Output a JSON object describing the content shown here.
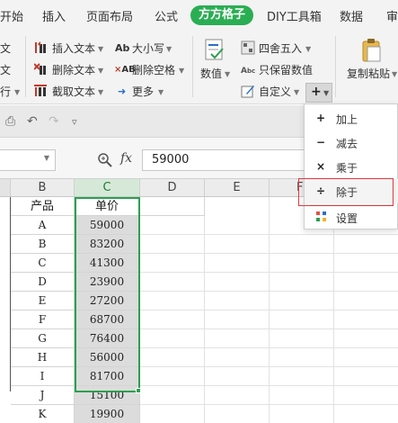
{
  "tabs": [
    {
      "label": "开始",
      "active": false
    },
    {
      "label": "插入",
      "active": false
    },
    {
      "label": "页面布局",
      "active": false
    },
    {
      "label": "公式",
      "active": false
    },
    {
      "label": "方方格子",
      "active": true
    },
    {
      "label": "DIY工具箱",
      "active": false
    },
    {
      "label": "数据",
      "active": false
    },
    {
      "label": "审",
      "active": false
    }
  ],
  "ribbon": {
    "col1": [
      "文",
      "文",
      "行"
    ],
    "text_group": {
      "insert_text": "插入文本",
      "delete_text": "删除文本",
      "extract_text": "截取文本"
    },
    "case_group": {
      "case": "大小写",
      "delete_spaces": "删除空格",
      "more": "更多"
    },
    "number_group": {
      "numeric": "数值",
      "round": "四舍五入",
      "keep_number": "只保留数值",
      "custom": "自定义"
    },
    "paste_group": {
      "copy_paste": "复制粘贴"
    },
    "op_button_symbol": "+"
  },
  "formula_bar": {
    "fx_label": "fx",
    "value": "59000"
  },
  "grid": {
    "columns": [
      "B",
      "C",
      "D",
      "E",
      "F"
    ],
    "header_row": {
      "b": "产品",
      "c": "单价"
    },
    "rows": [
      {
        "b": "A",
        "c": "59000"
      },
      {
        "b": "B",
        "c": "83200"
      },
      {
        "b": "C",
        "c": "41300"
      },
      {
        "b": "D",
        "c": "23900"
      },
      {
        "b": "E",
        "c": "27200"
      },
      {
        "b": "F",
        "c": "68700"
      },
      {
        "b": "G",
        "c": "76400"
      },
      {
        "b": "H",
        "c": "56000"
      },
      {
        "b": "I",
        "c": "81700"
      },
      {
        "b": "J",
        "c": "15100"
      },
      {
        "b": "K",
        "c": "19900"
      }
    ]
  },
  "menu": {
    "items": [
      {
        "icon": "plus-icon",
        "symbol": "+",
        "label": "加上"
      },
      {
        "icon": "minus-icon",
        "symbol": "−",
        "label": "减去"
      },
      {
        "icon": "multiply-icon",
        "symbol": "×",
        "label": "乘于"
      },
      {
        "icon": "divide-icon",
        "symbol": "÷",
        "label": "除于"
      },
      {
        "icon": "settings-icon",
        "symbol": "⁘",
        "label": "设置"
      }
    ]
  },
  "colors": {
    "accent_green": "#2aae53",
    "highlight_red": "#e0393e"
  }
}
